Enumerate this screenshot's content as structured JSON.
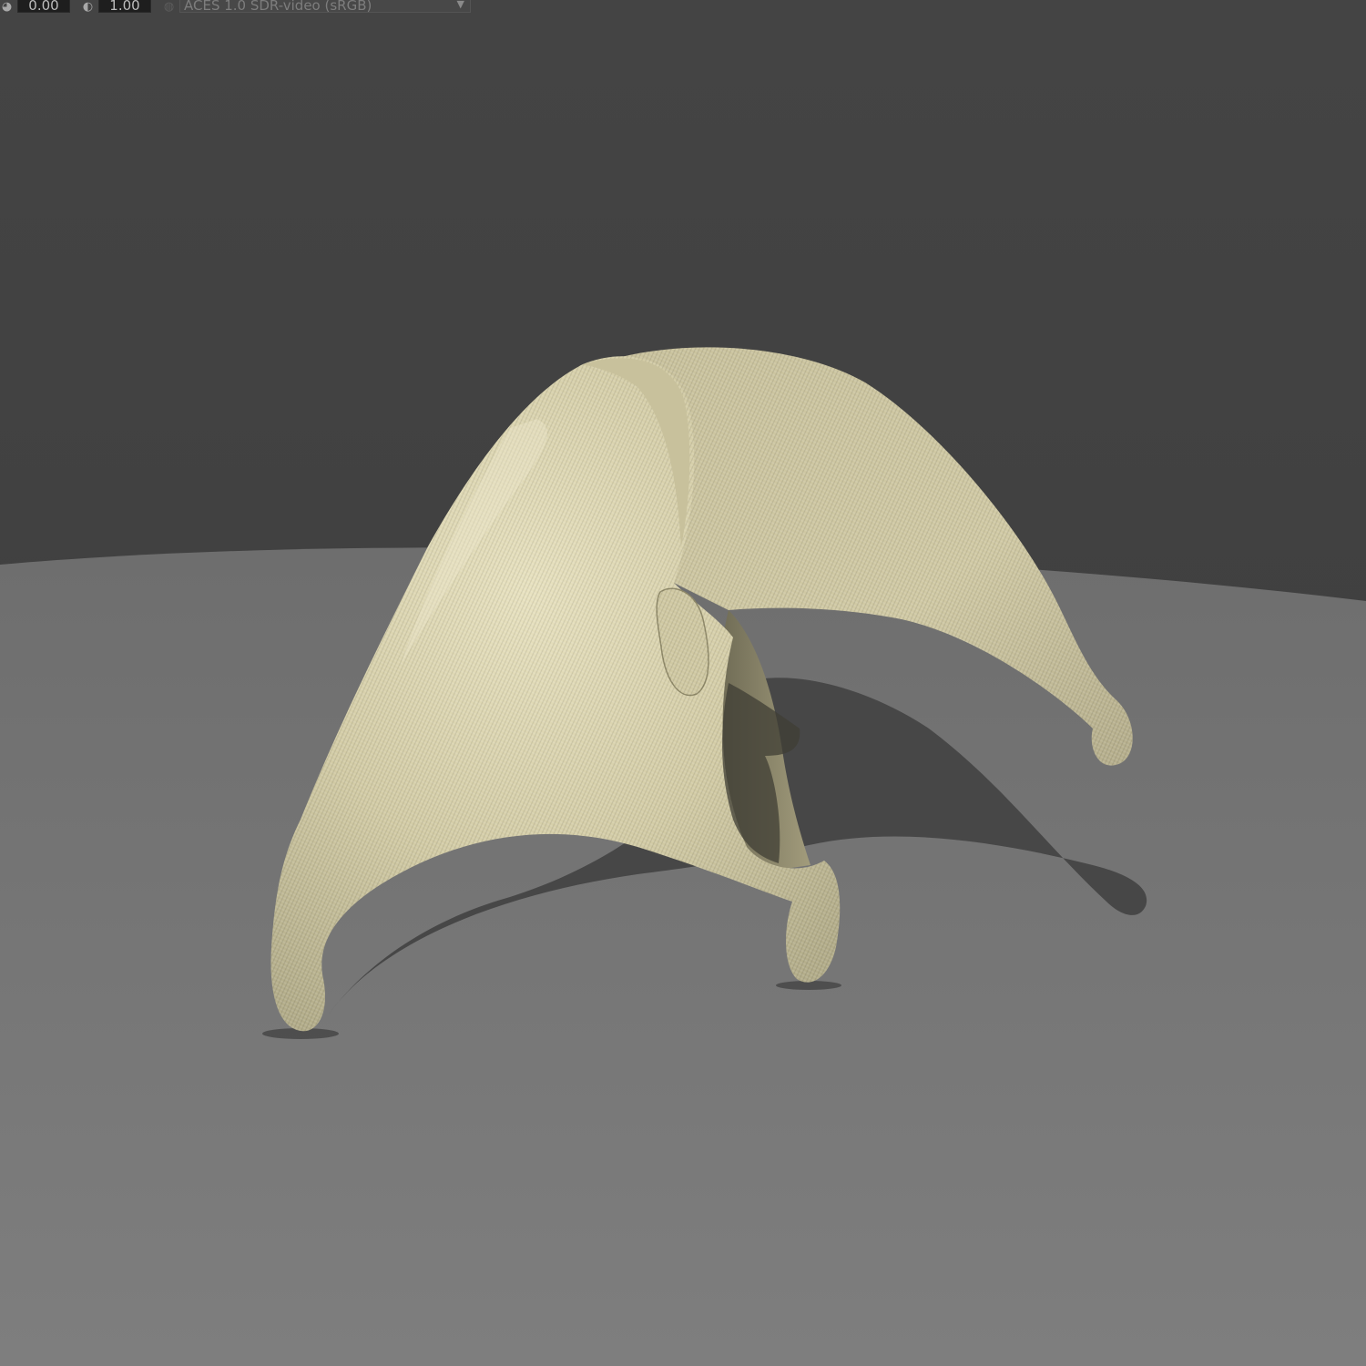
{
  "toolbar": {
    "exposure_icon": "aperture-icon",
    "exposure_value": "0.00",
    "gamma_icon": "gamma-icon",
    "gamma_value": "1.00",
    "view_icon": "display-icon",
    "view_transform": "ACES 1.0 SDR-video (sRGB)"
  },
  "viewport": {
    "background_color": "#404040",
    "floor_color": "#787878",
    "object_color": "#d7d1ac",
    "object_material": "woven burlap cloth"
  }
}
